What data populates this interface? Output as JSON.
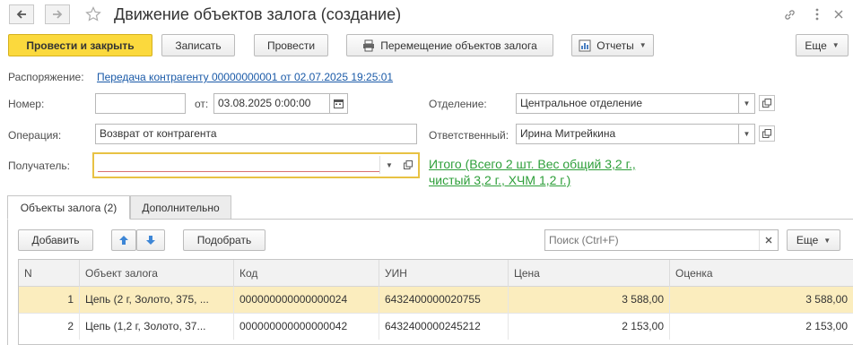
{
  "header": {
    "title": "Движение объектов залога (создание)",
    "more_label": "Еще"
  },
  "toolbar": {
    "post_close_label": "Провести и закрыть",
    "save_label": "Записать",
    "post_label": "Провести",
    "move_label": "Перемещение объектов залога",
    "reports_label": "Отчеты"
  },
  "form": {
    "order_label": "Распоряжение:",
    "order_link": "Передача контрагенту 00000000001 от 02.07.2025 19:25:01",
    "number_label": "Номер:",
    "number_value": "",
    "date_label": "от:",
    "date_value": "03.08.2025  0:00:00",
    "department_label": "Отделение:",
    "department_value": "Центральное отделение",
    "operation_label": "Операция:",
    "operation_value": "Возврат от контрагента",
    "responsible_label": "Ответственный:",
    "responsible_value": "Ирина Митрейкина",
    "recipient_label": "Получатель:",
    "recipient_value": "",
    "total_text": "Итого (Всего 2 шт. Вес общий 3,2 г., чистый 3,2 г., ХЧМ 1,2 г.)"
  },
  "tabs": [
    {
      "label": "Объекты залога (2)",
      "active": true
    },
    {
      "label": "Дополнительно",
      "active": false
    }
  ],
  "table_toolbar": {
    "add_label": "Добавить",
    "pick_label": "Подобрать",
    "search_placeholder": "Поиск (Ctrl+F)",
    "more_label": "Еще"
  },
  "table": {
    "columns": [
      "N",
      "Объект залога",
      "Код",
      "УИН",
      "Цена",
      "Оценка"
    ],
    "rows": [
      {
        "n": "1",
        "object": "Цепь (2 г, Золото, 375, ...",
        "code": "000000000000000024",
        "uin": "6432400000020755",
        "price": "3 588,00",
        "estimate": "3 588,00",
        "selected": true
      },
      {
        "n": "2",
        "object": "Цепь (1,2 г, Золото, 37...",
        "code": "000000000000000042",
        "uin": "6432400000245212",
        "price": "2 153,00",
        "estimate": "2 153,00",
        "selected": false
      }
    ]
  },
  "colors": {
    "primary_button": "#fbd93d",
    "link": "#1a5aa8",
    "total_link": "#2e9f3a",
    "selected_row": "#fbedbe",
    "required_border": "#e8c243"
  }
}
